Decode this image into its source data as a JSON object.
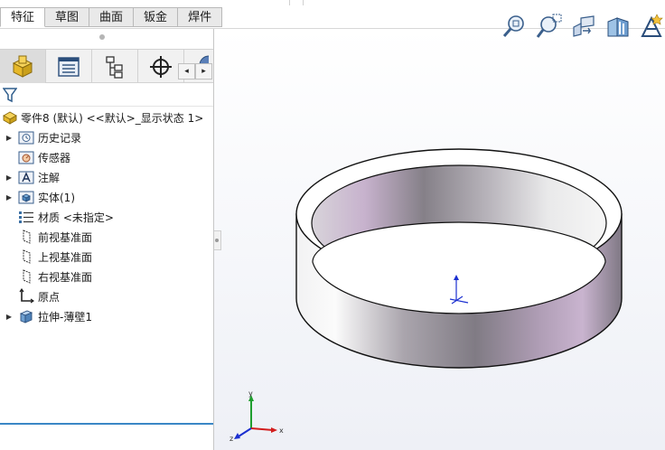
{
  "command_tabs": [
    {
      "label": "特征",
      "active": true
    },
    {
      "label": "草图",
      "active": false
    },
    {
      "label": "曲面",
      "active": false
    },
    {
      "label": "钣金",
      "active": false
    },
    {
      "label": "焊件",
      "active": false
    }
  ],
  "panel_tabs": [
    {
      "icon": "feature-manager-icon",
      "active": true
    },
    {
      "icon": "property-manager-icon",
      "active": false
    },
    {
      "icon": "configuration-manager-icon",
      "active": false
    },
    {
      "icon": "dimxpert-manager-icon",
      "active": false
    }
  ],
  "scroll_buttons": {
    "left": "◂",
    "right": "▸"
  },
  "tree": {
    "root_label": "零件8 (默认) <<默认>_显示状态 1>",
    "items": [
      {
        "label": "历史记录",
        "icon": "history-folder-icon",
        "expandable": true
      },
      {
        "label": "传感器",
        "icon": "sensor-icon",
        "expandable": false
      },
      {
        "label": "注解",
        "icon": "annotation-icon",
        "expandable": true
      },
      {
        "label": "实体(1)",
        "icon": "solid-bodies-icon",
        "expandable": true
      },
      {
        "label": "材质 <未指定>",
        "icon": "material-icon",
        "expandable": false
      },
      {
        "label": "前视基准面",
        "icon": "plane-icon",
        "expandable": false
      },
      {
        "label": "上视基准面",
        "icon": "plane-icon",
        "expandable": false
      },
      {
        "label": "右视基准面",
        "icon": "plane-icon",
        "expandable": false
      },
      {
        "label": "原点",
        "icon": "origin-icon",
        "expandable": false
      },
      {
        "label": "拉伸-薄壁1",
        "icon": "extrude-feature-icon",
        "expandable": true
      }
    ],
    "expand_glyph": "▶"
  },
  "view_toolbar": [
    "zoom-to-fit-icon",
    "zoom-to-area-icon",
    "previous-view-icon",
    "section-view-icon",
    "view-orientation-icon"
  ],
  "triad": {
    "x": "x",
    "y": "y",
    "z": "z"
  },
  "colors": {
    "tree_end_line": "#3a87c6",
    "part_shade": "#8f8a96",
    "part_highlight": "#c9b4cf"
  }
}
